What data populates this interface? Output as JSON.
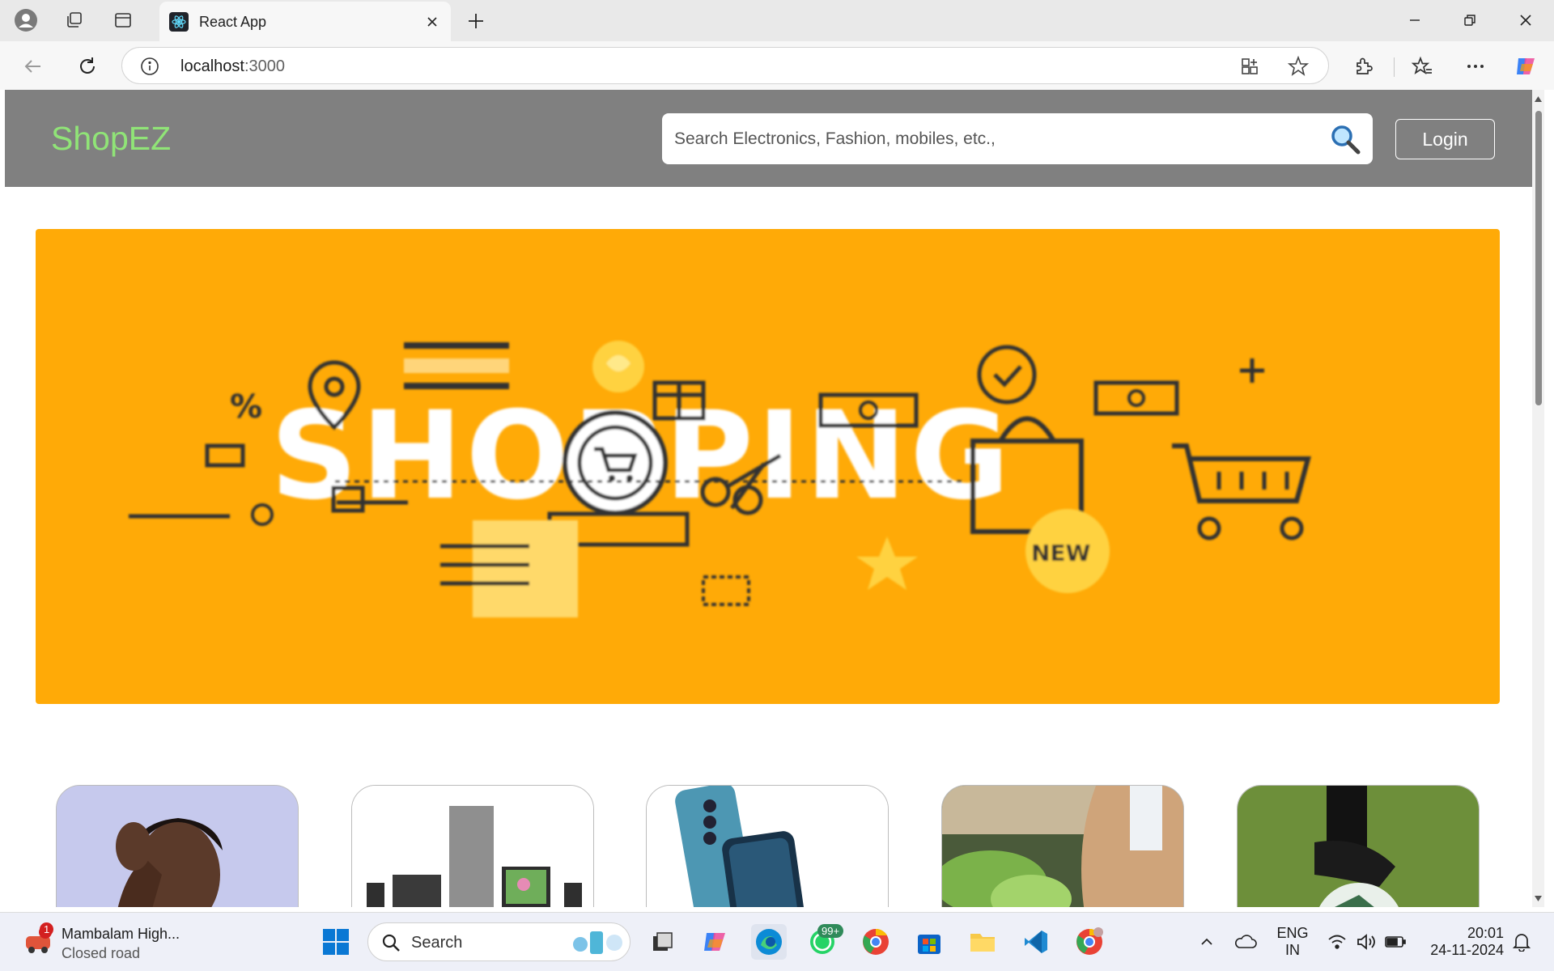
{
  "browser": {
    "tab_title": "React App",
    "url_host": "localhost",
    "url_port": ":3000"
  },
  "page": {
    "brand": "ShopEZ",
    "search_placeholder": "Search Electronics, Fashion, mobiles, etc.,",
    "login_label": "Login",
    "banner": {
      "word": "SHOPPING",
      "tag": "NEW",
      "percent": "%",
      "background_color": "#ffaa07"
    },
    "categories": [
      {
        "icon": "man-portrait-image"
      },
      {
        "icon": "home-appliances-image"
      },
      {
        "icon": "mobile-phones-image"
      },
      {
        "icon": "groceries-image"
      },
      {
        "icon": "sports-football-image"
      }
    ],
    "colors": {
      "navbar": "#808080",
      "brand": "#90e477"
    }
  },
  "taskbar": {
    "weather_title": "Mambalam High...",
    "weather_subtitle": "Closed road",
    "weather_badge": "1",
    "search_label": "Search",
    "whatsapp_badge": "99+",
    "language": "ENG",
    "region": "IN",
    "time": "20:01",
    "date": "24-11-2024"
  }
}
